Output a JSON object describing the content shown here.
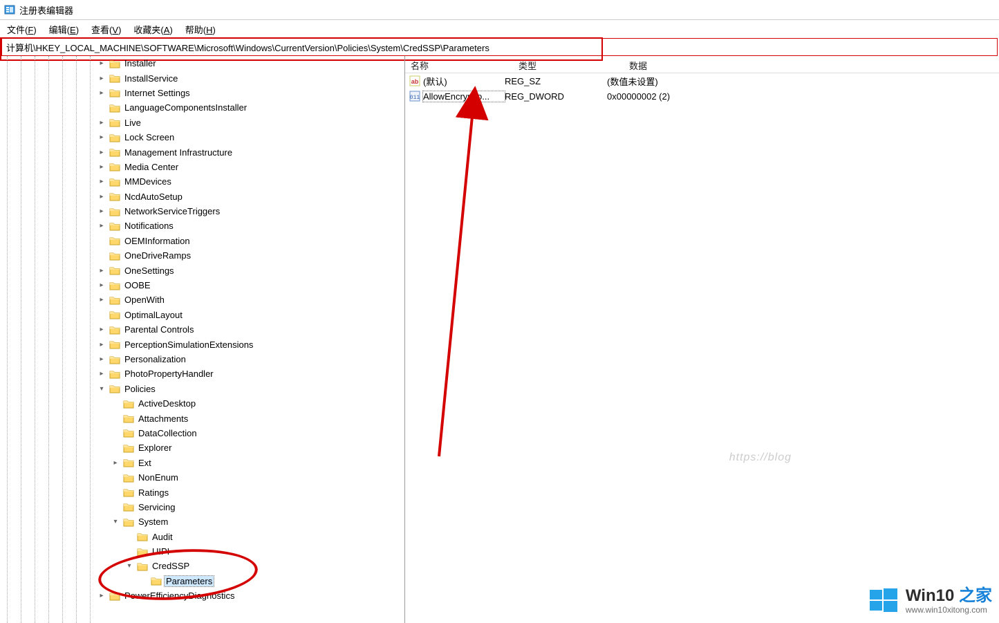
{
  "window": {
    "title": "注册表编辑器"
  },
  "menu": {
    "file": {
      "label": "文件",
      "accel": "F"
    },
    "edit": {
      "label": "编辑",
      "accel": "E"
    },
    "view": {
      "label": "查看",
      "accel": "V"
    },
    "fav": {
      "label": "收藏夹",
      "accel": "A"
    },
    "help": {
      "label": "帮助",
      "accel": "H"
    }
  },
  "address": {
    "value": "计算机\\HKEY_LOCAL_MACHINE\\SOFTWARE\\Microsoft\\Windows\\CurrentVersion\\Policies\\System\\CredSSP\\Parameters"
  },
  "columns": {
    "name": "名称",
    "type": "类型",
    "data": "数据"
  },
  "values": [
    {
      "icon": "sz",
      "name": "(默认)",
      "type": "REG_SZ",
      "data": "(数值未设置)"
    },
    {
      "icon": "dword",
      "name": "AllowEncryptio...",
      "type": "REG_DWORD",
      "data": "0x00000002 (2)",
      "selected": true
    }
  ],
  "tree": [
    {
      "d": 7,
      "tw": ">",
      "label": "Installer"
    },
    {
      "d": 7,
      "tw": ">",
      "label": "InstallService"
    },
    {
      "d": 7,
      "tw": ">",
      "label": "Internet Settings"
    },
    {
      "d": 7,
      "tw": "",
      "label": "LanguageComponentsInstaller"
    },
    {
      "d": 7,
      "tw": ">",
      "label": "Live"
    },
    {
      "d": 7,
      "tw": ">",
      "label": "Lock Screen"
    },
    {
      "d": 7,
      "tw": ">",
      "label": "Management Infrastructure"
    },
    {
      "d": 7,
      "tw": ">",
      "label": "Media Center"
    },
    {
      "d": 7,
      "tw": ">",
      "label": "MMDevices"
    },
    {
      "d": 7,
      "tw": ">",
      "label": "NcdAutoSetup"
    },
    {
      "d": 7,
      "tw": ">",
      "label": "NetworkServiceTriggers"
    },
    {
      "d": 7,
      "tw": ">",
      "label": "Notifications"
    },
    {
      "d": 7,
      "tw": "",
      "label": "OEMInformation"
    },
    {
      "d": 7,
      "tw": "",
      "label": "OneDriveRamps"
    },
    {
      "d": 7,
      "tw": ">",
      "label": "OneSettings"
    },
    {
      "d": 7,
      "tw": ">",
      "label": "OOBE"
    },
    {
      "d": 7,
      "tw": ">",
      "label": "OpenWith"
    },
    {
      "d": 7,
      "tw": "",
      "label": "OptimalLayout"
    },
    {
      "d": 7,
      "tw": ">",
      "label": "Parental Controls"
    },
    {
      "d": 7,
      "tw": ">",
      "label": "PerceptionSimulationExtensions"
    },
    {
      "d": 7,
      "tw": ">",
      "label": "Personalization"
    },
    {
      "d": 7,
      "tw": ">",
      "label": "PhotoPropertyHandler"
    },
    {
      "d": 7,
      "tw": "v",
      "label": "Policies"
    },
    {
      "d": 8,
      "tw": "",
      "label": "ActiveDesktop"
    },
    {
      "d": 8,
      "tw": "",
      "label": "Attachments"
    },
    {
      "d": 8,
      "tw": "",
      "label": "DataCollection"
    },
    {
      "d": 8,
      "tw": "",
      "label": "Explorer"
    },
    {
      "d": 8,
      "tw": ">",
      "label": "Ext"
    },
    {
      "d": 8,
      "tw": "",
      "label": "NonEnum"
    },
    {
      "d": 8,
      "tw": "",
      "label": "Ratings"
    },
    {
      "d": 8,
      "tw": "",
      "label": "Servicing"
    },
    {
      "d": 8,
      "tw": "v",
      "label": "System"
    },
    {
      "d": 9,
      "tw": "",
      "label": "Audit"
    },
    {
      "d": 9,
      "tw": "",
      "label": "UIPI"
    },
    {
      "d": 9,
      "tw": "v",
      "label": "CredSSP"
    },
    {
      "d": 10,
      "tw": "",
      "label": "Parameters",
      "selected": true
    },
    {
      "d": 7,
      "tw": ">",
      "label": "PowerEfficiencyDiagnostics"
    }
  ],
  "watermark": {
    "brand_en": "Win10",
    "brand_zh": "之家",
    "url": "www.win10xitong.com"
  },
  "faint_text": "https://blog"
}
